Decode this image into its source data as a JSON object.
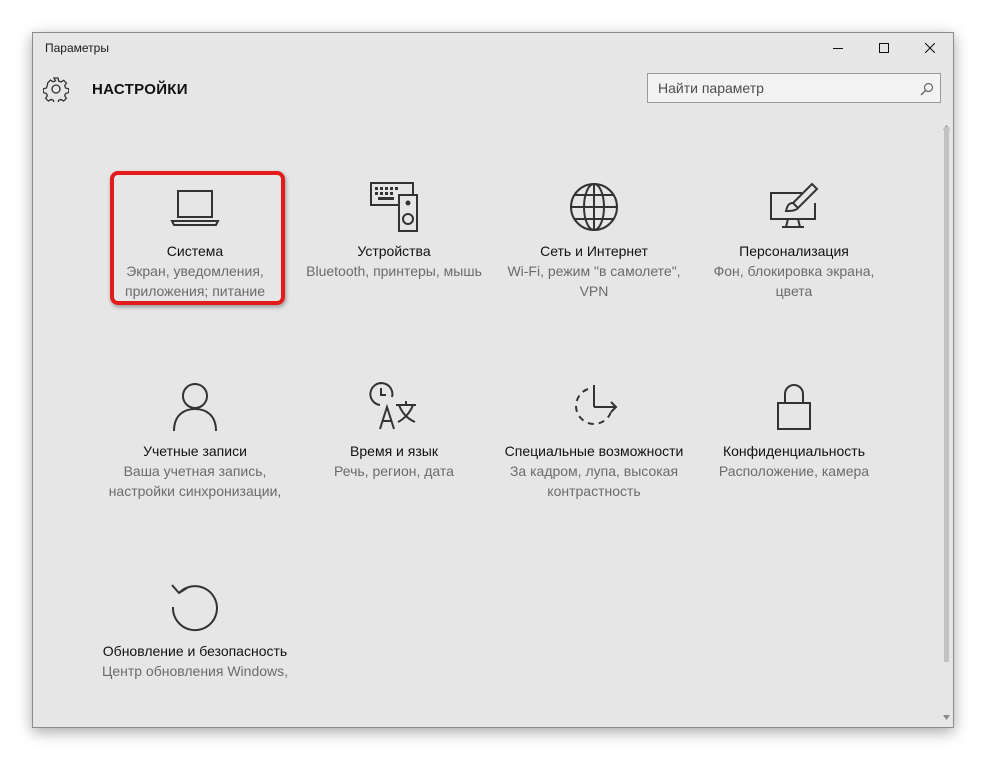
{
  "window": {
    "title": "Параметры"
  },
  "header": {
    "title": "НАСТРОЙКИ",
    "search_placeholder": "Найти параметр"
  },
  "tiles": [
    {
      "name": "Система",
      "desc": "Экран, уведомления, приложения; питание",
      "icon": "laptop-icon"
    },
    {
      "name": "Устройства",
      "desc": "Bluetooth, принтеры, мышь",
      "icon": "devices-icon"
    },
    {
      "name": "Сеть и Интернет",
      "desc": "Wi-Fi, режим \"в самолете\", VPN",
      "icon": "globe-icon"
    },
    {
      "name": "Персонализация",
      "desc": "Фон, блокировка экрана, цвета",
      "icon": "personalization-icon"
    },
    {
      "name": "Учетные записи",
      "desc": "Ваша учетная запись, настройки синхронизации,",
      "icon": "user-icon"
    },
    {
      "name": "Время и язык",
      "desc": "Речь, регион, дата",
      "icon": "time-language-icon"
    },
    {
      "name": "Специальные возможности",
      "desc": "За кадром, лупа, высокая контрастность",
      "icon": "accessibility-icon"
    },
    {
      "name": "Конфиденциальность",
      "desc": "Расположение, камера",
      "icon": "lock-icon"
    },
    {
      "name": "Обновление и безопасность",
      "desc": "Центр обновления Windows,",
      "icon": "update-icon"
    }
  ],
  "highlight_color": "#e31b1b"
}
